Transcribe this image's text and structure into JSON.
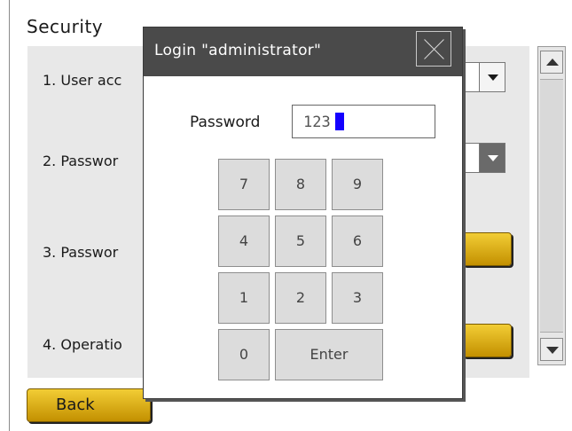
{
  "screen": {
    "title": "Security",
    "rows": [
      {
        "label": "1. User acc"
      },
      {
        "label": "2. Passwor"
      },
      {
        "label": "3. Passwor"
      },
      {
        "label": "4. Operatio"
      }
    ],
    "back_label": "Back"
  },
  "dialog": {
    "title": "Login \"administrator\"",
    "password_label": "Password",
    "password_value": "123",
    "keypad": [
      "7",
      "8",
      "9",
      "4",
      "5",
      "6",
      "1",
      "2",
      "3",
      "0",
      "Enter"
    ]
  },
  "icons": {
    "close": "close-icon",
    "dropdown": "chevron-down-icon",
    "scroll_up": "arrow-up-icon",
    "scroll_down": "arrow-down-icon"
  },
  "colors": {
    "accent_gold": "#e8b814",
    "dialog_titlebar": "#4a4a4a",
    "cursor_blue": "#1400ff",
    "panel_bg": "#e8e8e8"
  }
}
